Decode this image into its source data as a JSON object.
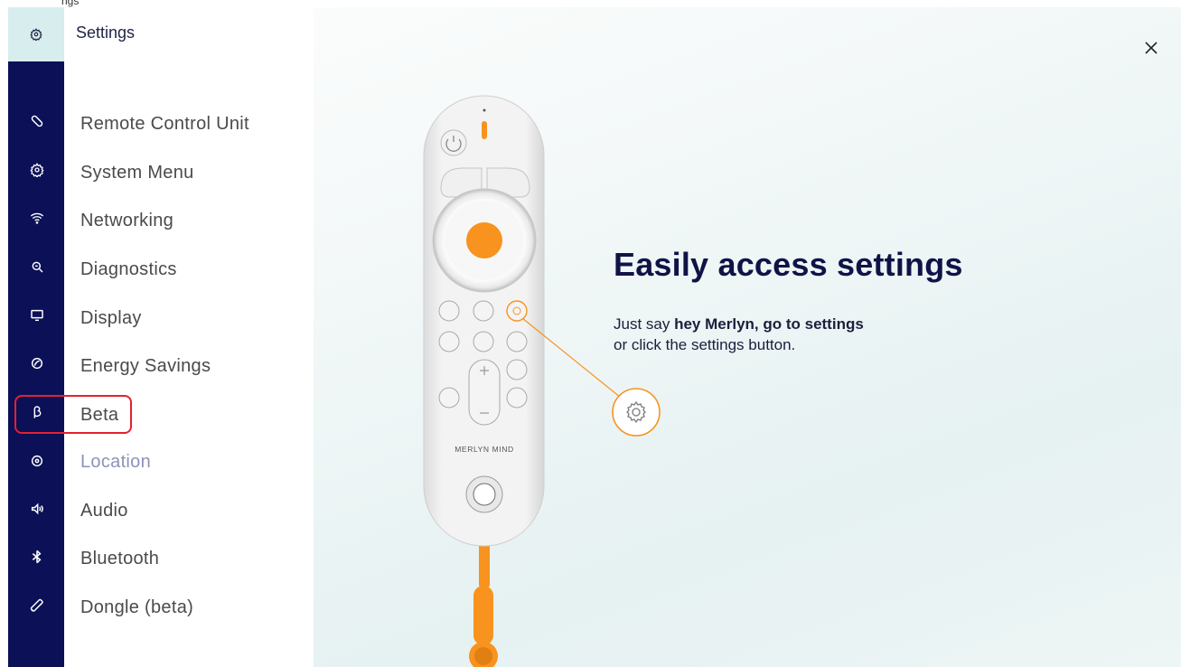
{
  "window": {
    "top_label": "ngs"
  },
  "header": {
    "title": "Settings",
    "icon": "gear-icon"
  },
  "sidebar": {
    "items": [
      {
        "label": "Remote Control Unit",
        "icon": "remote-icon",
        "state": "normal"
      },
      {
        "label": "System Menu",
        "icon": "gear-cog-icon",
        "state": "normal"
      },
      {
        "label": "Networking",
        "icon": "wifi-icon",
        "state": "normal"
      },
      {
        "label": "Diagnostics",
        "icon": "magnifier-icon",
        "state": "normal"
      },
      {
        "label": "Display",
        "icon": "monitor-icon",
        "state": "normal"
      },
      {
        "label": "Energy Savings",
        "icon": "leaf-icon",
        "state": "normal"
      },
      {
        "label": "Beta",
        "icon": "beta-icon",
        "state": "highlighted"
      },
      {
        "label": "Location",
        "icon": "location-pin-icon",
        "state": "dim"
      },
      {
        "label": "Audio",
        "icon": "speaker-icon",
        "state": "normal"
      },
      {
        "label": "Bluetooth",
        "icon": "bluetooth-icon",
        "state": "normal"
      },
      {
        "label": "Dongle (beta)",
        "icon": "dongle-icon",
        "state": "normal"
      }
    ]
  },
  "main": {
    "headline": "Easily access settings",
    "instruction_prefix": "Just say ",
    "instruction_bold": "hey Merlyn, go to settings",
    "instruction_suffix": "or click the settings button.",
    "remote_brand": "MERLYN MIND"
  },
  "colors": {
    "rail": "#0b1057",
    "header_cell": "#d8eded",
    "accent_orange": "#f7931e",
    "highlight_red": "#e4212f",
    "headline": "#0f1447"
  }
}
